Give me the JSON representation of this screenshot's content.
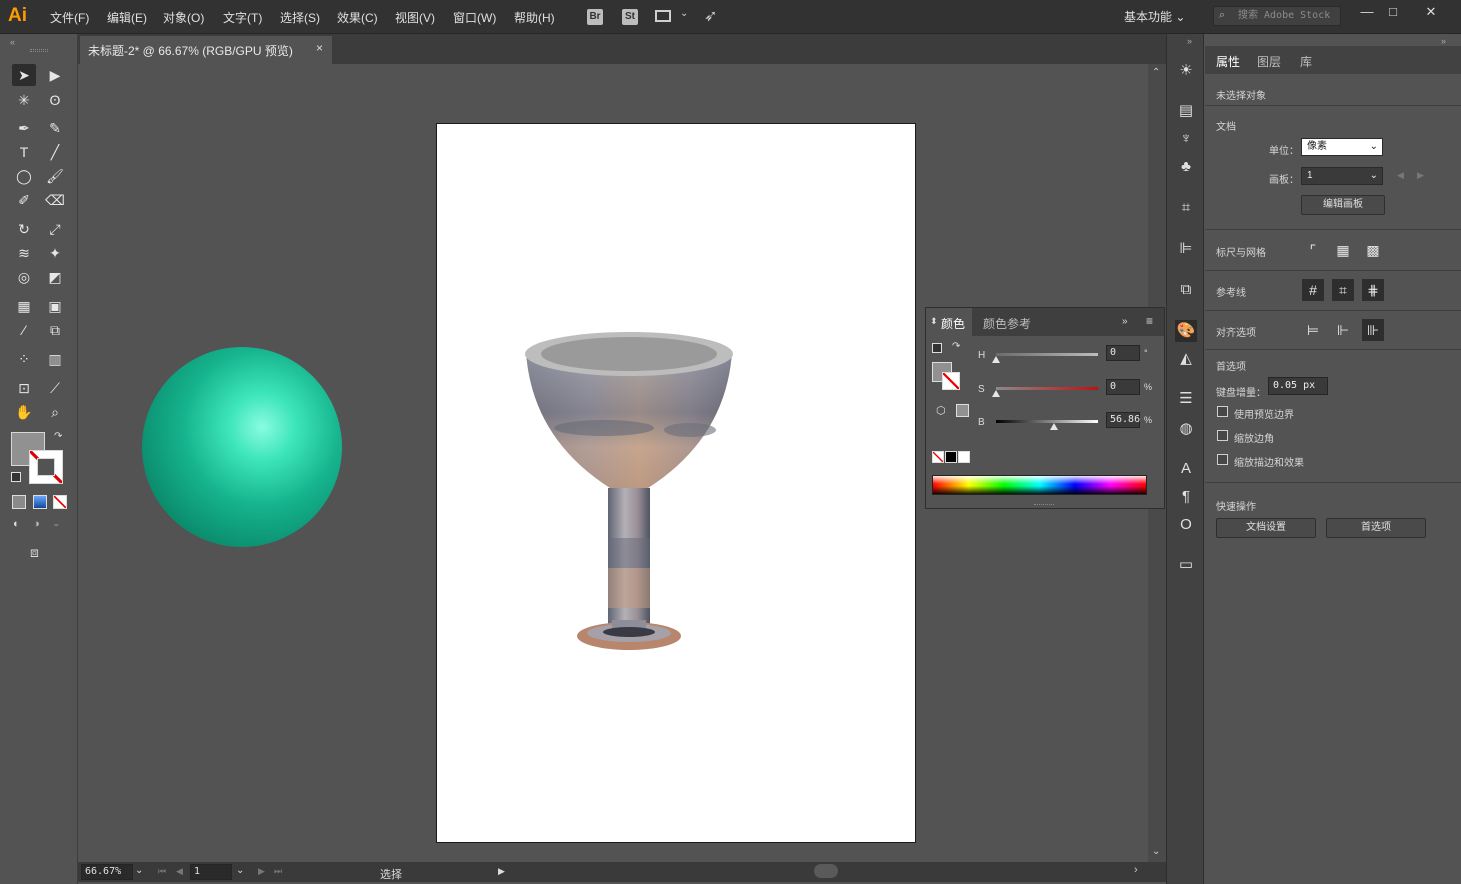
{
  "app": {
    "logo": "Ai"
  },
  "menu": [
    "文件(F)",
    "编辑(E)",
    "对象(O)",
    "文字(T)",
    "选择(S)",
    "效果(C)",
    "视图(V)",
    "窗口(W)",
    "帮助(H)"
  ],
  "menu_icons": {
    "bridge": "Br",
    "stock": "St"
  },
  "workspace": {
    "label": "基本功能"
  },
  "search": {
    "placeholder": "搜索 Adobe Stock"
  },
  "document": {
    "tab_title": "未标题-2* @ 66.67% (RGB/GPU 预览)",
    "close": "×"
  },
  "status": {
    "zoom": "66.67%",
    "artboard": "1",
    "tool_name": "选择"
  },
  "properties": {
    "tabs": [
      "属性",
      "图层",
      "库"
    ],
    "selection": "未选择对象",
    "document_section": "文档",
    "units_label": "单位：",
    "units_value": "像素",
    "artboard_label": "画板：",
    "artboard_value": "1",
    "edit_artboards_btn": "编辑画板",
    "rulers_grids": "标尺与网格",
    "guides": "参考线",
    "align_options": "对齐选项",
    "preferences": "首选项",
    "keyboard_inc_label": "键盘增量：",
    "keyboard_inc_value": "0.05 px",
    "cb_preview_bounds": "使用预览边界",
    "cb_scale_corners": "缩放边角",
    "cb_scale_strokes": "缩放描边和效果",
    "quick_actions": "快速操作",
    "doc_setup_btn": "文档设置",
    "prefs_btn": "首选项"
  },
  "color_panel": {
    "tabs": [
      "颜色",
      "颜色参考"
    ],
    "h_label": "H",
    "h_value": "0",
    "h_unit": "°",
    "s_label": "S",
    "s_value": "0",
    "s_unit": "%",
    "b_label": "B",
    "b_value": "56.86",
    "b_unit": "%",
    "h_level": 0,
    "s_level": 0,
    "b_level": 0.5686
  },
  "colors": {
    "sphere_outer": "#0a8e6e",
    "sphere_inner": "#7cf7da",
    "fill_swatch": "#919191"
  }
}
